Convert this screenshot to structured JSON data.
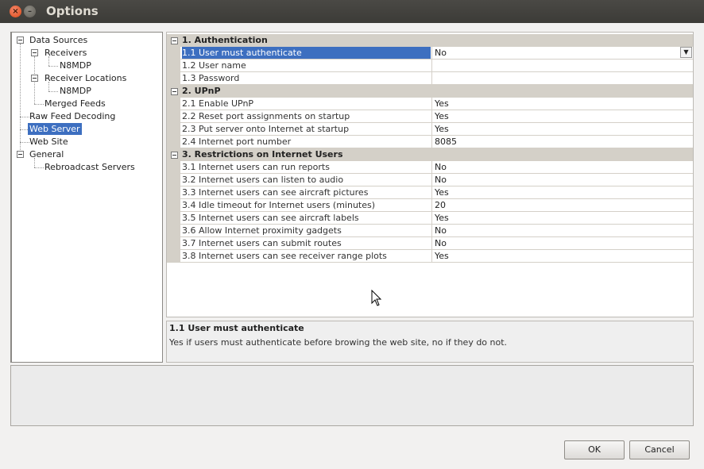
{
  "window": {
    "title": "Options"
  },
  "tree": {
    "items": [
      {
        "label": "Data Sources"
      },
      {
        "label": "Receivers"
      },
      {
        "label": "N8MDP"
      },
      {
        "label": "Receiver Locations"
      },
      {
        "label": "N8MDP"
      },
      {
        "label": "Merged Feeds"
      },
      {
        "label": "Raw Feed Decoding"
      },
      {
        "label": "Web Server",
        "selected": true
      },
      {
        "label": "Web Site"
      },
      {
        "label": "General"
      },
      {
        "label": "Rebroadcast Servers"
      }
    ]
  },
  "grid": {
    "categories": [
      {
        "label": "1. Authentication",
        "rows": [
          {
            "name": "1.1 User must authenticate",
            "value": "No",
            "selected": true,
            "dropdown": true
          },
          {
            "name": "1.2 User name",
            "value": ""
          },
          {
            "name": "1.3 Password",
            "value": ""
          }
        ]
      },
      {
        "label": "2. UPnP",
        "rows": [
          {
            "name": "2.1 Enable UPnP",
            "value": "Yes"
          },
          {
            "name": "2.2 Reset port assignments on startup",
            "value": "Yes"
          },
          {
            "name": "2.3 Put server onto Internet at startup",
            "value": "Yes"
          },
          {
            "name": "2.4 Internet port number",
            "value": "8085"
          }
        ]
      },
      {
        "label": "3. Restrictions on Internet Users",
        "rows": [
          {
            "name": "3.1 Internet users can run reports",
            "value": "No"
          },
          {
            "name": "3.2 Internet users can listen to audio",
            "value": "No"
          },
          {
            "name": "3.3 Internet users can see aircraft pictures",
            "value": "Yes"
          },
          {
            "name": "3.4 Idle timeout for Internet users (minutes)",
            "value": "20"
          },
          {
            "name": "3.5 Internet users can see aircraft labels",
            "value": "Yes"
          },
          {
            "name": "3.6 Allow Internet proximity gadgets",
            "value": "No"
          },
          {
            "name": "3.7 Internet users can submit routes",
            "value": "No"
          },
          {
            "name": "3.8 Internet users can see receiver range plots",
            "value": "Yes"
          }
        ]
      }
    ]
  },
  "help": {
    "title": "1.1 User must authenticate",
    "description": "Yes if users must authenticate before browing the web site, no if they do not."
  },
  "buttons": {
    "ok": "OK",
    "cancel": "Cancel"
  },
  "icons": {
    "close": "close-icon",
    "minimize": "minimize-icon",
    "dropdown": "chevron-down-icon",
    "cursor": "mouse-pointer-icon"
  },
  "colors": {
    "selection": "#3d6fc0",
    "titlebar": "#3c3b37",
    "category_band": "#d4d0c8"
  }
}
